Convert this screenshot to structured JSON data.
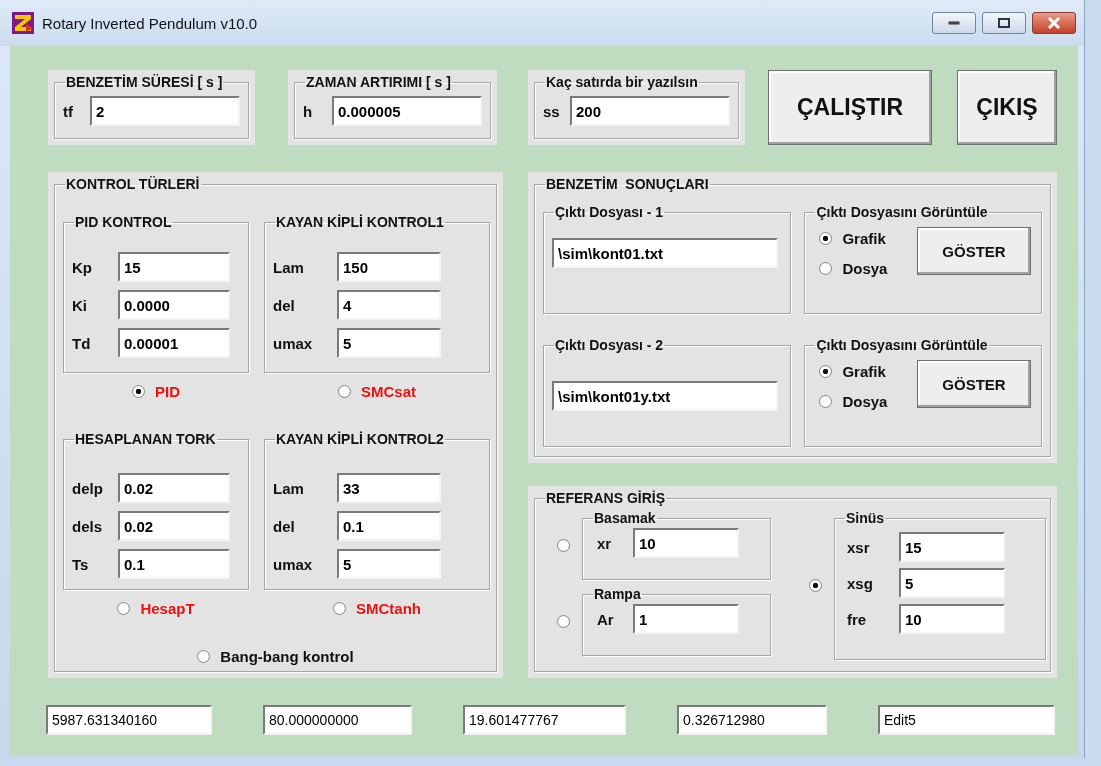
{
  "window": {
    "title": "Rotary Inverted Pendulum v10.0"
  },
  "settings": [
    {
      "title": "BENZETİM SÜRESİ [ s ]",
      "label": "tf",
      "value": "2"
    },
    {
      "title": "ZAMAN ARTIRIMI [ s ]",
      "label": "h",
      "value": "0.000005"
    },
    {
      "title": "Kaç satırda bir yazılsın",
      "label": "ss",
      "value": "200"
    }
  ],
  "buttons": [
    {
      "label": "ÇALIŞTIR"
    },
    {
      "label": "ÇIKIŞ"
    }
  ],
  "control_types": {
    "title": "KONTROL TÜRLERİ",
    "groups": [
      {
        "title": "PID KONTROL",
        "fields": [
          {
            "label": "Kp",
            "value": "15"
          },
          {
            "label": "Ki",
            "value": "0.0000"
          },
          {
            "label": "Td",
            "value": "0.00001"
          }
        ],
        "option": {
          "label": "PID",
          "selected": true
        }
      },
      {
        "title": "KAYAN KİPLİ KONTROL1",
        "fields": [
          {
            "label": "Lam",
            "value": "150"
          },
          {
            "label": "del",
            "value": "4"
          },
          {
            "label": "umax",
            "value": "5"
          }
        ],
        "option": {
          "label": "SMCsat",
          "selected": false
        }
      },
      {
        "title": "HESAPLANAN TORK",
        "fields": [
          {
            "label": "delp",
            "value": "0.02"
          },
          {
            "label": "dels",
            "value": "0.02"
          },
          {
            "label": "Ts",
            "value": "0.1"
          }
        ],
        "option": {
          "label": "HesapT",
          "selected": false
        }
      },
      {
        "title": "KAYAN KİPLİ KONTROL2",
        "fields": [
          {
            "label": "Lam",
            "value": "33"
          },
          {
            "label": "del",
            "value": "0.1"
          },
          {
            "label": "umax",
            "value": "5"
          }
        ],
        "option": {
          "label": "SMCtanh",
          "selected": false
        }
      }
    ],
    "bang_bang": {
      "label": "Bang-bang kontrol",
      "selected": false
    }
  },
  "results": {
    "title": "BENZETİM  SONUÇLARI",
    "outputs": [
      {
        "title": "Çıktı Dosyası - 1",
        "value": "\\sim\\kont01.txt",
        "view_title": "Çıktı Dosyasını Görüntüle",
        "options": [
          {
            "label": "Grafik",
            "selected": true
          },
          {
            "label": "Dosya",
            "selected": false
          }
        ],
        "button": "GÖSTER"
      },
      {
        "title": "Çıktı Dosyası - 2",
        "value": "\\sim\\kont01y.txt",
        "view_title": "Çıktı Dosyasını Görüntüle",
        "options": [
          {
            "label": "Grafik",
            "selected": true
          },
          {
            "label": "Dosya",
            "selected": false
          }
        ],
        "button": "GÖSTER"
      }
    ]
  },
  "reference": {
    "title": "REFERANS GİRİŞ",
    "modes": [
      {
        "title": "Basamak",
        "selected": false,
        "fields": [
          {
            "label": "xr",
            "value": "10"
          }
        ]
      },
      {
        "title": "Rampa",
        "selected": false,
        "fields": [
          {
            "label": "Ar",
            "value": "1"
          }
        ]
      },
      {
        "title": "Sinüs",
        "selected": true,
        "fields": [
          {
            "label": "xsr",
            "value": "15"
          },
          {
            "label": "xsg",
            "value": "5"
          },
          {
            "label": "fre",
            "value": "10"
          }
        ]
      }
    ]
  },
  "status_fields": [
    "5987.631340160",
    "80.000000000",
    "19.601477767",
    "0.326712980",
    "Edit5"
  ]
}
